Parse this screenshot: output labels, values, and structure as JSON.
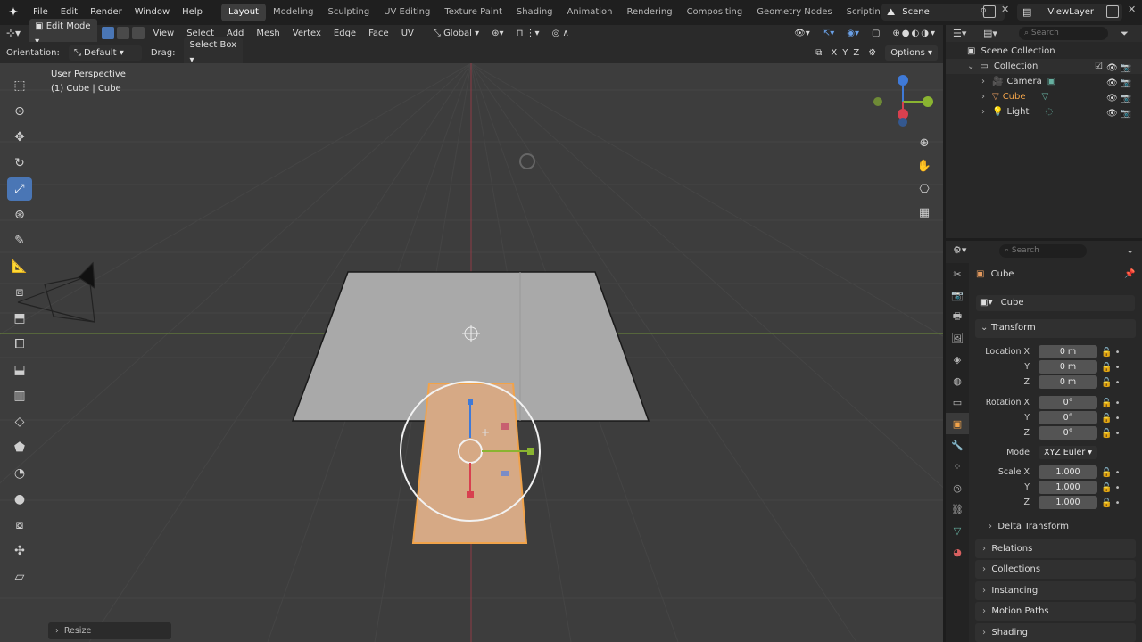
{
  "topbar": {
    "menus": [
      "File",
      "Edit",
      "Render",
      "Window",
      "Help"
    ],
    "workspaces": [
      "Layout",
      "Modeling",
      "Sculpting",
      "UV Editing",
      "Texture Paint",
      "Shading",
      "Animation",
      "Rendering",
      "Compositing",
      "Geometry Nodes",
      "Scripting"
    ],
    "active_workspace": "Layout",
    "scene": "Scene",
    "viewlayer": "ViewLayer"
  },
  "header3d": {
    "mode": "Edit Mode",
    "menus": [
      "View",
      "Select",
      "Add",
      "Mesh",
      "Vertex",
      "Edge",
      "Face",
      "UV"
    ],
    "transform_orientation": "Global"
  },
  "header2": {
    "orientation_label": "Orientation:",
    "orientation_value": "Default",
    "drag_label": "Drag:",
    "drag_value": "Select Box",
    "axes": [
      "X",
      "Y",
      "Z"
    ],
    "options": "Options"
  },
  "viewport": {
    "perspective": "User Perspective",
    "object_info": "(1) Cube | Cube",
    "last_op": "Resize"
  },
  "outliner": {
    "search_placeholder": "Search",
    "root": "Scene Collection",
    "collection": "Collection",
    "items": [
      "Camera",
      "Cube",
      "Light"
    ]
  },
  "properties": {
    "search_placeholder": "Search",
    "object_name": "Cube",
    "data_name": "Cube",
    "transform_title": "Transform",
    "location_label": "Location X",
    "location": [
      "0 m",
      "0 m",
      "0 m"
    ],
    "rotation_label": "Rotation X",
    "rotation": [
      "0°",
      "0°",
      "0°"
    ],
    "mode_label": "Mode",
    "mode_value": "XYZ Euler",
    "scale_label": "Scale X",
    "scale": [
      "1.000",
      "1.000",
      "1.000"
    ],
    "axis_y": "Y",
    "axis_z": "Z",
    "delta": "Delta Transform",
    "panels": [
      "Relations",
      "Collections",
      "Instancing",
      "Motion Paths",
      "Shading"
    ]
  },
  "colors": {
    "accent": "#4a76b5",
    "selected_orange": "#f1a34a",
    "axis_red": "#d8404f",
    "axis_green": "#8ab431",
    "axis_blue": "#3f7ad8"
  }
}
